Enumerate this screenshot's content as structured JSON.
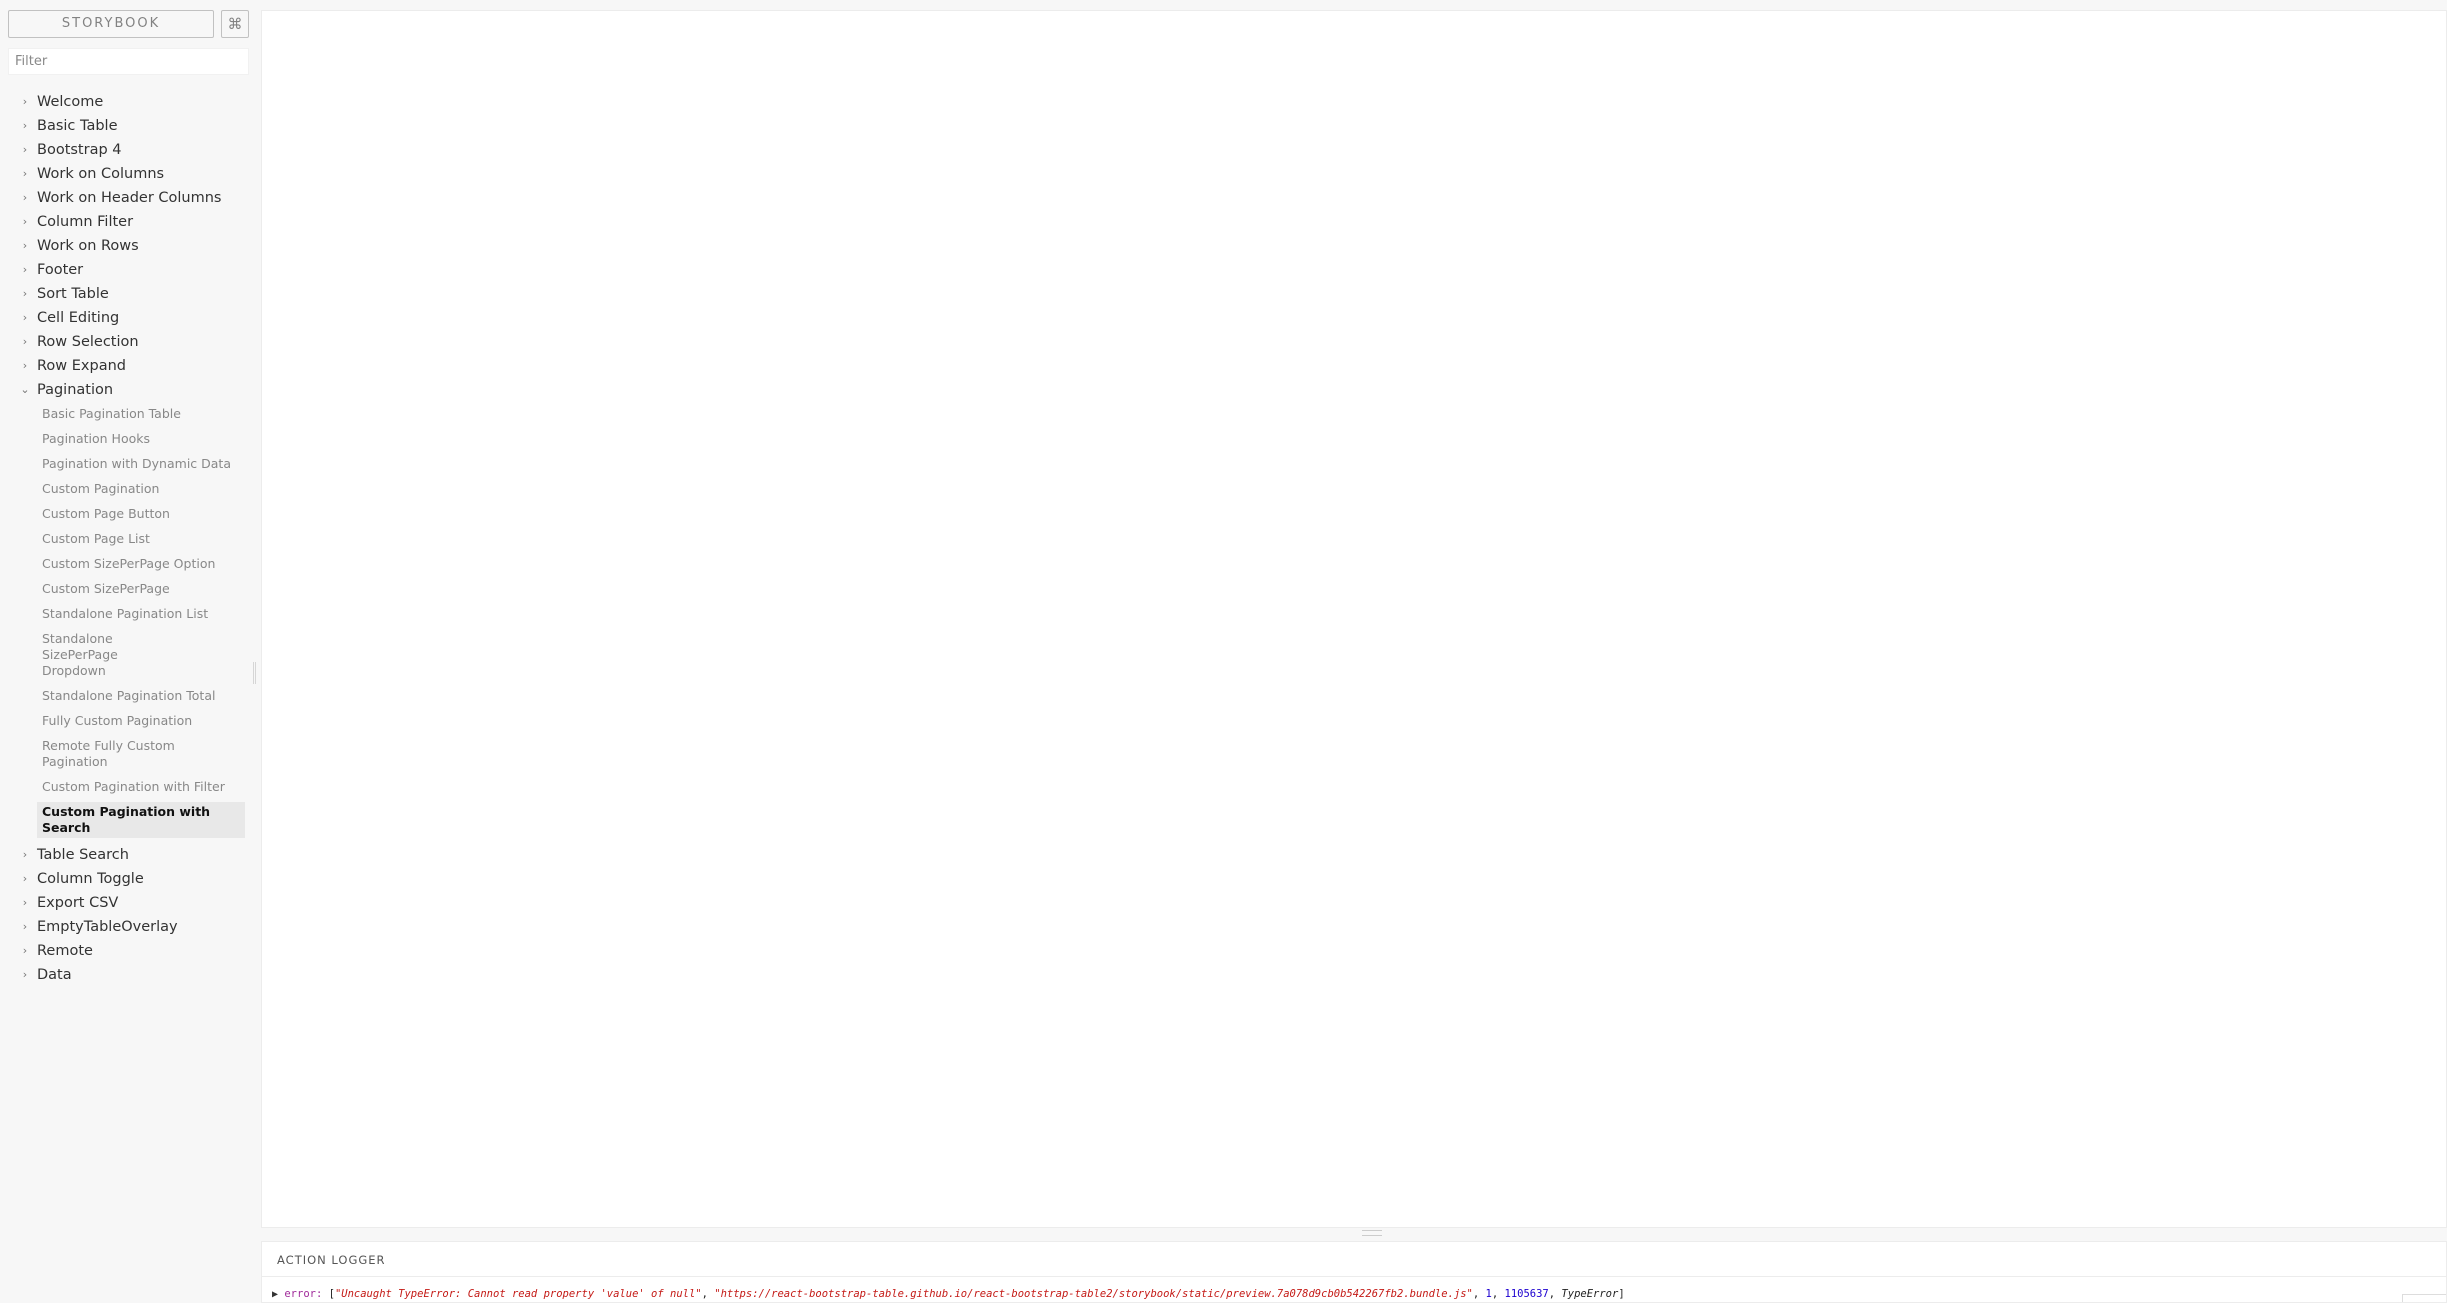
{
  "sidebar": {
    "brand": "STORYBOOK",
    "shortcut_icon": "⌘",
    "filter_placeholder": "Filter",
    "kinds_before": [
      {
        "label": "Welcome"
      },
      {
        "label": "Basic Table"
      },
      {
        "label": "Bootstrap 4"
      },
      {
        "label": "Work on Columns"
      },
      {
        "label": "Work on Header Columns"
      },
      {
        "label": "Column Filter"
      },
      {
        "label": "Work on Rows"
      },
      {
        "label": "Footer"
      },
      {
        "label": "Sort Table"
      },
      {
        "label": "Cell Editing"
      },
      {
        "label": "Row Selection"
      },
      {
        "label": "Row Expand"
      }
    ],
    "expanded_kind": {
      "label": "Pagination",
      "stories": [
        "Basic Pagination Table",
        "Pagination Hooks",
        "Pagination with Dynamic Data",
        "Custom Pagination",
        "Custom Page Button",
        "Custom Page List",
        "Custom SizePerPage Option",
        "Custom SizePerPage",
        "Standalone Pagination List",
        "Standalone SizePerPage Dropdown",
        "Standalone Pagination Total",
        "Fully Custom Pagination",
        "Remote Fully Custom Pagination",
        "Custom Pagination with Filter",
        "Custom Pagination with Search"
      ],
      "selected_story": "Custom Pagination with Search"
    },
    "kinds_after": [
      {
        "label": "Table Search"
      },
      {
        "label": "Column Toggle"
      },
      {
        "label": "Export CSV"
      },
      {
        "label": "EmptyTableOverlay"
      },
      {
        "label": "Remote"
      },
      {
        "label": "Data"
      }
    ]
  },
  "panel": {
    "tab_label": "ACTION LOGGER",
    "log": {
      "key": "error:",
      "message": "\"Uncaught TypeError: Cannot read property 'value' of null\"",
      "url": "\"https://react-bootstrap-table.github.io/react-bootstrap-table2/storybook/static/preview.7a078d9cb0b542267fb2.bundle.js\"",
      "line": "1",
      "column": "1105637",
      "error_type": "TypeError"
    }
  },
  "icons": {
    "collapsed": "chevron-right-icon",
    "expanded": "chevron-down-icon",
    "log_toggle": "triangle-right-icon"
  }
}
